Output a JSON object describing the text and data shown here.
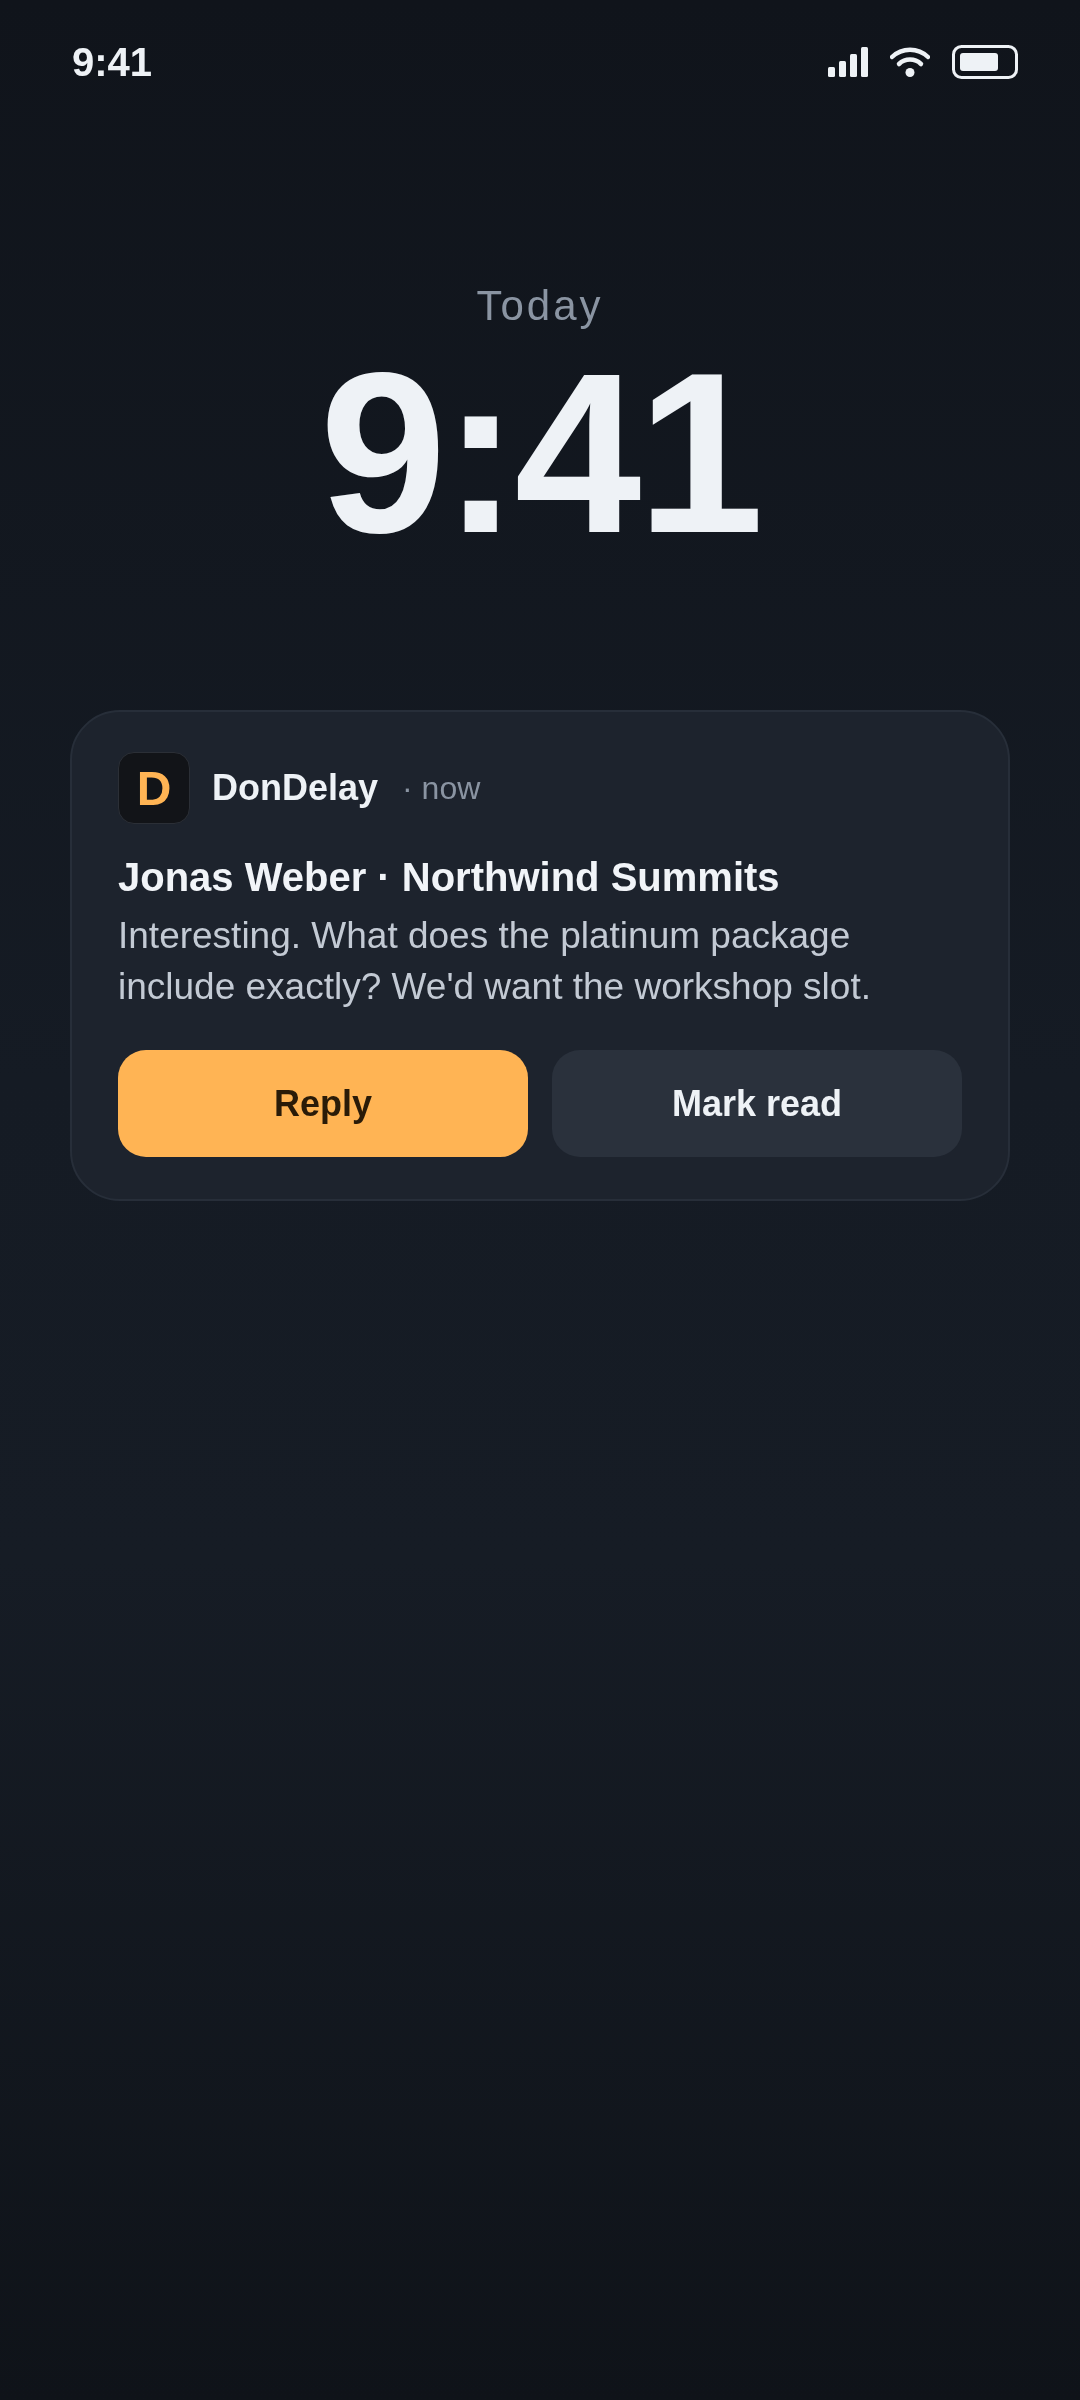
{
  "status_bar": {
    "time": "9:41"
  },
  "lock_screen": {
    "date": "Today",
    "time": "9:41"
  },
  "notification": {
    "app": {
      "icon_letter": "D",
      "name": "DonDelay",
      "time": "· now"
    },
    "title": "Jonas Weber · Northwind Summits",
    "body": "Interesting. What does the platinum package include exactly? We'd want the workshop slot.",
    "actions": [
      {
        "label": "Reply",
        "kind": "primary"
      },
      {
        "label": "Mark read",
        "kind": "secondary"
      }
    ]
  }
}
